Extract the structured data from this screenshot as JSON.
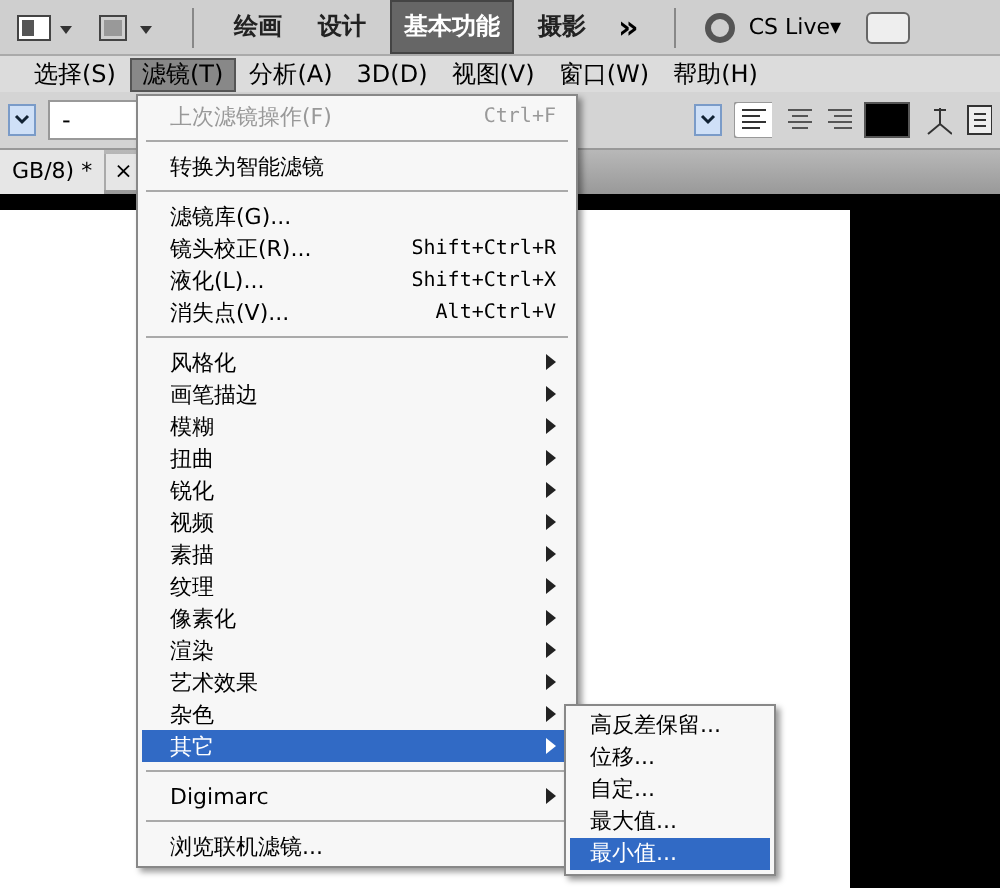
{
  "top_bar": {
    "workspaces": [
      {
        "label": "绘画",
        "selected": false
      },
      {
        "label": "设计",
        "selected": false
      },
      {
        "label": "基本功能",
        "selected": true
      },
      {
        "label": "摄影",
        "selected": false
      }
    ],
    "more": "»",
    "cs_live": "CS Live▾"
  },
  "menubar": [
    {
      "label": "选择(S)",
      "selected": false
    },
    {
      "label": "滤镜(T)",
      "selected": true
    },
    {
      "label": "分析(A)",
      "selected": false
    },
    {
      "label": "3D(D)",
      "selected": false
    },
    {
      "label": "视图(V)",
      "selected": false
    },
    {
      "label": "窗口(W)",
      "selected": false
    },
    {
      "label": "帮助(H)",
      "selected": false
    }
  ],
  "option_bar": {
    "font_size": "-"
  },
  "document_tab": {
    "title": "GB/8) *",
    "close": "×"
  },
  "filter_menu": [
    {
      "kind": "item",
      "label": "上次滤镜操作(F)",
      "shortcut": "Ctrl+F",
      "disabled": true,
      "selected": false
    },
    {
      "kind": "separator"
    },
    {
      "kind": "item",
      "label": "转换为智能滤镜",
      "disabled": false,
      "selected": false
    },
    {
      "kind": "separator"
    },
    {
      "kind": "item",
      "label": "滤镜库(G)...",
      "disabled": false,
      "selected": false
    },
    {
      "kind": "item",
      "label": "镜头校正(R)...",
      "shortcut": "Shift+Ctrl+R",
      "disabled": false,
      "selected": false
    },
    {
      "kind": "item",
      "label": "液化(L)...",
      "shortcut": "Shift+Ctrl+X",
      "disabled": false,
      "selected": false
    },
    {
      "kind": "item",
      "label": "消失点(V)...",
      "shortcut": "Alt+Ctrl+V",
      "disabled": false,
      "selected": false
    },
    {
      "kind": "separator"
    },
    {
      "kind": "submenu",
      "label": "风格化",
      "selected": false
    },
    {
      "kind": "submenu",
      "label": "画笔描边",
      "selected": false
    },
    {
      "kind": "submenu",
      "label": "模糊",
      "selected": false
    },
    {
      "kind": "submenu",
      "label": "扭曲",
      "selected": false
    },
    {
      "kind": "submenu",
      "label": "锐化",
      "selected": false
    },
    {
      "kind": "submenu",
      "label": "视频",
      "selected": false
    },
    {
      "kind": "submenu",
      "label": "素描",
      "selected": false
    },
    {
      "kind": "submenu",
      "label": "纹理",
      "selected": false
    },
    {
      "kind": "submenu",
      "label": "像素化",
      "selected": false
    },
    {
      "kind": "submenu",
      "label": "渲染",
      "selected": false
    },
    {
      "kind": "submenu",
      "label": "艺术效果",
      "selected": false
    },
    {
      "kind": "submenu",
      "label": "杂色",
      "selected": false
    },
    {
      "kind": "submenu",
      "label": "其它",
      "selected": true
    },
    {
      "kind": "separator"
    },
    {
      "kind": "submenu",
      "label": "Digimarc",
      "selected": false
    },
    {
      "kind": "separator"
    },
    {
      "kind": "item",
      "label": "浏览联机滤镜...",
      "disabled": false,
      "selected": false
    }
  ],
  "other_submenu": [
    {
      "label": "高反差保留...",
      "selected": false
    },
    {
      "label": "位移...",
      "selected": false
    },
    {
      "label": "自定...",
      "selected": false
    },
    {
      "label": "最大值...",
      "selected": false
    },
    {
      "label": "最小值...",
      "selected": true
    }
  ]
}
